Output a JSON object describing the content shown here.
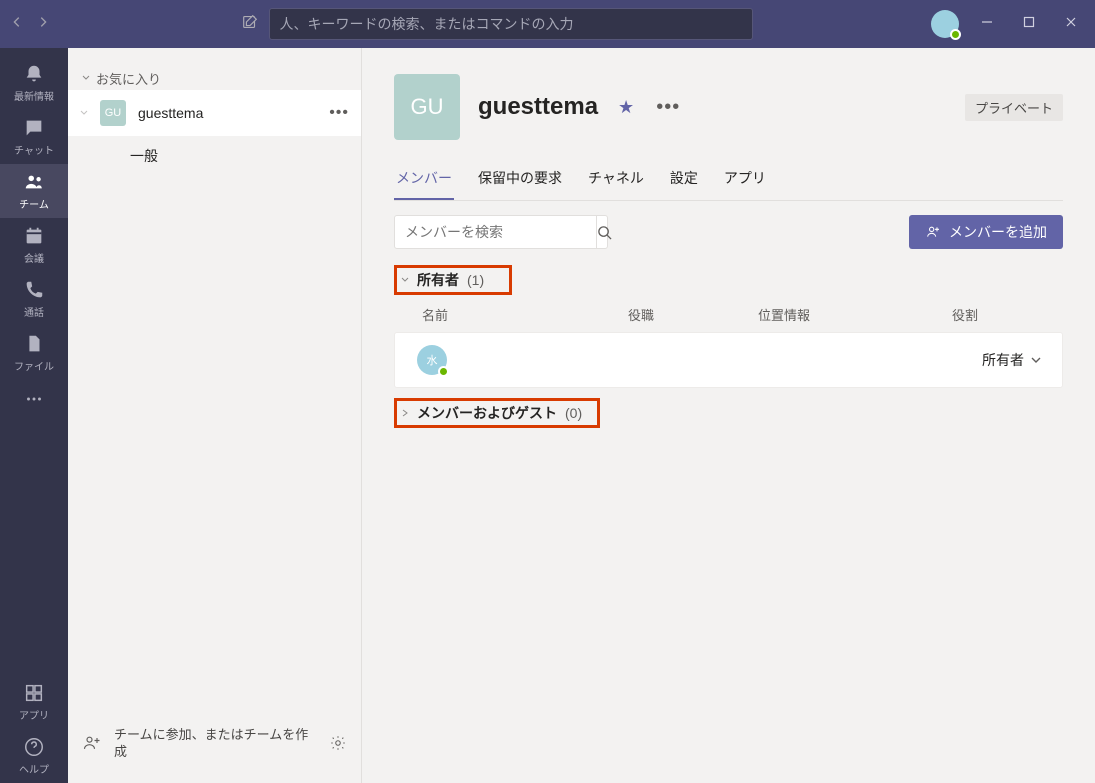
{
  "titlebar": {
    "search_placeholder": "人、キーワードの検索、またはコマンドの入力"
  },
  "rail": {
    "items": [
      {
        "id": "activity",
        "label": "最新情報"
      },
      {
        "id": "chat",
        "label": "チャット"
      },
      {
        "id": "teams",
        "label": "チーム"
      },
      {
        "id": "meetings",
        "label": "会議"
      },
      {
        "id": "calls",
        "label": "通話"
      },
      {
        "id": "files",
        "label": "ファイル"
      }
    ],
    "apps_label": "アプリ",
    "help_label": "ヘルプ"
  },
  "team_panel": {
    "favorites_header": "お気に入り",
    "team": {
      "initials": "GU",
      "name": "guesttema"
    },
    "channels": [
      {
        "name": "一般"
      }
    ],
    "join_create_label": "チームに参加、またはチームを作成"
  },
  "main": {
    "team": {
      "initials": "GU",
      "name": "guesttema",
      "private_badge": "プライベート"
    },
    "tabs": [
      {
        "id": "members",
        "label": "メンバー",
        "active": true
      },
      {
        "id": "requests",
        "label": "保留中の要求"
      },
      {
        "id": "channels",
        "label": "チャネル"
      },
      {
        "id": "settings",
        "label": "設定"
      },
      {
        "id": "apps",
        "label": "アプリ"
      }
    ],
    "search_members_placeholder": "メンバーを検索",
    "add_member_label": "メンバーを追加",
    "owners_section": {
      "title": "所有者",
      "count": "(1)"
    },
    "columns": {
      "name": "名前",
      "role": "役職",
      "location": "位置情報",
      "assignment": "役割"
    },
    "owner_row": {
      "avatar_text": "水",
      "role_label": "所有者"
    },
    "guests_section": {
      "title": "メンバーおよびゲスト",
      "count": "(0)"
    }
  }
}
